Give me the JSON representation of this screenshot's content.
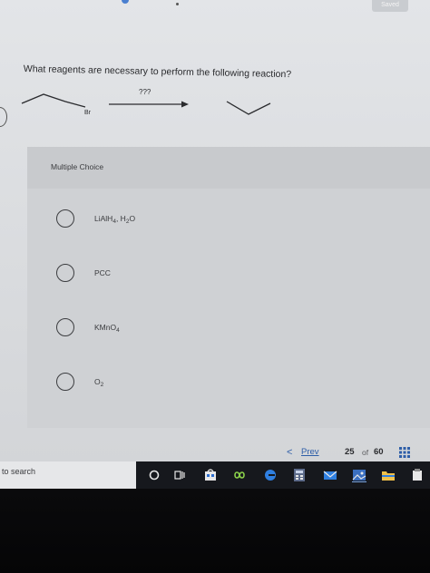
{
  "header": {
    "saved_label": "Saved"
  },
  "question": {
    "prompt": "What reagents are necessary to perform the following reaction?",
    "arrow_label": "???",
    "substituent_label": "Br"
  },
  "multiple_choice": {
    "title": "Multiple Choice",
    "options": [
      {
        "parts": [
          "LiAlH",
          "4",
          ", H",
          "2",
          "O"
        ]
      },
      {
        "parts": [
          "PCC"
        ]
      },
      {
        "parts": [
          "KMnO",
          "4"
        ]
      },
      {
        "parts": [
          "O",
          "2"
        ]
      }
    ]
  },
  "pagination": {
    "prev_chevron": "<",
    "prev_label": "Prev",
    "current": "25",
    "of_label": "of",
    "total": "60"
  },
  "taskbar": {
    "search_text": "to search",
    "icons": [
      "cortana-circle-icon",
      "task-view-icon",
      "store-icon",
      "infinity-app-icon",
      "edge-icon",
      "calculator-icon",
      "mail-icon",
      "photos-icon",
      "file-explorer-icon",
      "app-icon"
    ]
  },
  "colors": {
    "link": "#2e5ea8",
    "text": "#2a2b2e",
    "taskbar": "#16181d"
  }
}
